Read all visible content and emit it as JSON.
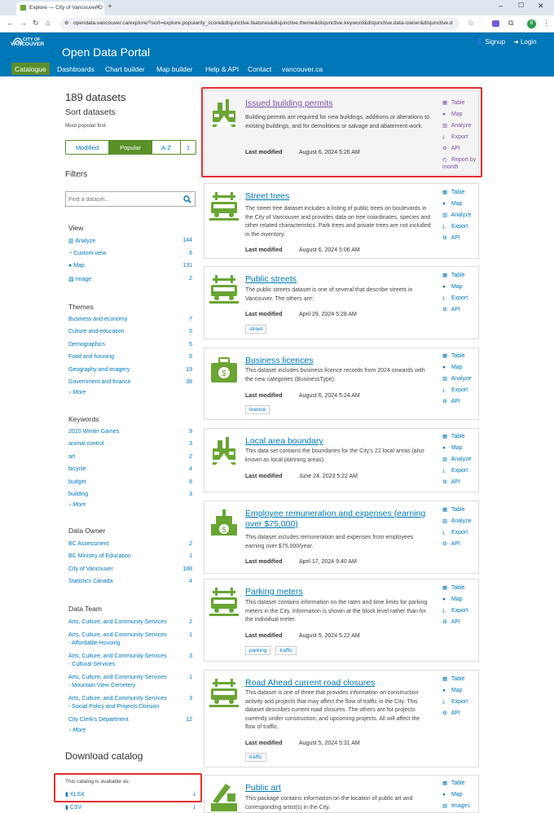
{
  "browser": {
    "tab_title": "Explore — City of Vancouver O",
    "url": "opendata.vancouver.ca/explore/?sort=explore.popularity_score&disjunctive.features&disjunctive.theme&disjunctive.keyword&disjunctive.data-owner&disjunctive.d"
  },
  "header": {
    "logo_line1": "CITY OF",
    "logo_line2": "VANCOUVER",
    "title": "Open Data Portal",
    "signup": "Signup",
    "login": "Login",
    "nav": [
      "Catalogue",
      "Dashboards",
      "Chart builder",
      "Map builder",
      "Help & API",
      "Contact",
      "vancouver.ca"
    ]
  },
  "left": {
    "count": "189 datasets",
    "sort_title": "Sort datasets",
    "sort_sub": "Most popular first",
    "sort_options": [
      "Modified",
      "Popular",
      "A-Z",
      "1"
    ],
    "filters_title": "Filters",
    "search_placeholder": "Find a dataset...",
    "view": {
      "title": "View",
      "items": [
        {
          "label": "Analyze",
          "count": "144"
        },
        {
          "label": "Custom view",
          "count": "6"
        },
        {
          "label": "Map",
          "count": "131"
        },
        {
          "label": "Image",
          "count": "2"
        }
      ]
    },
    "themes": {
      "title": "Themes",
      "items": [
        {
          "label": "Business and economy",
          "count": "7"
        },
        {
          "label": "Culture and education",
          "count": "5"
        },
        {
          "label": "Demographics",
          "count": "5"
        },
        {
          "label": "Food and housing",
          "count": "6"
        },
        {
          "label": "Geography and imagery",
          "count": "19"
        },
        {
          "label": "Government and finance",
          "count": "38"
        }
      ],
      "more": "More"
    },
    "keywords": {
      "title": "Keywords",
      "items": [
        {
          "label": "2010 Winter Games",
          "count": "9"
        },
        {
          "label": "animal control",
          "count": "3"
        },
        {
          "label": "art",
          "count": "2"
        },
        {
          "label": "bicycle",
          "count": "4"
        },
        {
          "label": "budget",
          "count": "8"
        },
        {
          "label": "building",
          "count": "3"
        }
      ],
      "more": "More"
    },
    "data_owner": {
      "title": "Data Owner",
      "items": [
        {
          "label": "BC Assessment",
          "count": "2"
        },
        {
          "label": "BC Ministry of Education",
          "count": "1"
        },
        {
          "label": "City of Vancouver",
          "count": "188"
        },
        {
          "label": "Statistics Canada",
          "count": "4"
        }
      ]
    },
    "data_team": {
      "title": "Data Team",
      "items": [
        {
          "line1": "Arts, Culture, and Community Services",
          "line2": "",
          "count": "2"
        },
        {
          "line1": "Arts, Culture, and Community Services",
          "line2": "- Affordable Housing",
          "count": "1"
        },
        {
          "line1": "Arts, Culture, and Community Services",
          "line2": "- Cultural Services",
          "count": "3"
        },
        {
          "line1": "Arts, Culture, and Community Services",
          "line2": "- Mountain View Cemetery",
          "count": "1"
        },
        {
          "line1": "Arts, Culture, and Community Services",
          "line2": "- Social Policy and Projects Division",
          "count": "3"
        },
        {
          "line1": "City Clerk's Department",
          "line2": "",
          "count": "12"
        }
      ],
      "more": "More"
    },
    "download": {
      "title": "Download catalog",
      "sub": "This catalog is available as:",
      "formats": [
        "XLSX",
        "CSV"
      ]
    }
  },
  "datasets": [
    {
      "title": "Issued building permits",
      "desc": "Building permits are required for new buildings, additions or alterations to existing buildings, and for demolitions or salvage and abatement work.",
      "lm_label": "Last modified",
      "lm": "August 6, 2024 5:26 AM",
      "tags": [],
      "actions": [
        "Table",
        "Map",
        "Analyze",
        "Export",
        "API",
        "Report by month"
      ]
    },
    {
      "title": "Street trees",
      "desc": "The street tree dataset includes a listing of public trees on boulevards in the City of Vancouver and provides data on tree coordinates, species and other related characteristics. Park trees and private trees are not included in the inventory.",
      "lm_label": "Last modified",
      "lm": "August 6, 2024 5:06 AM",
      "tags": [],
      "actions": [
        "Table",
        "Map",
        "Analyze",
        "Export",
        "API"
      ]
    },
    {
      "title": "Public streets",
      "desc": "The public streets dataset is one of several that describe streets in Vancouver. The others are:",
      "lm_label": "Last modified",
      "lm": "April 29, 2024 5:28 AM",
      "tags": [
        "street"
      ],
      "actions": [
        "Table",
        "Map",
        "Export",
        "API"
      ]
    },
    {
      "title": "Business licences",
      "desc": "This dataset includes business licence records from 2024 onwards with the new categories (BusinessType).",
      "lm_label": "Last modified",
      "lm": "August 6, 2024 5:24 AM",
      "tags": [
        "licence"
      ],
      "actions": [
        "Table",
        "Map",
        "Analyze",
        "Export",
        "API"
      ]
    },
    {
      "title": "Local area boundary",
      "desc": "This data set contains the boundaries for the City's 22 local areas (also known as local planning areas).",
      "lm_label": "Last modified",
      "lm": "June 24, 2023 5:22 AM",
      "tags": [],
      "actions": [
        "Table",
        "Map",
        "Analyze",
        "Export",
        "API"
      ]
    },
    {
      "title": "Employee remuneration and expenses (earning over $75,000)",
      "desc": "This dataset includes remuneration and expenses from employees earning over $75,000/year.",
      "lm_label": "Last modified",
      "lm": "April 17, 2024 9:40 AM",
      "tags": [],
      "actions": [
        "Table",
        "Analyze",
        "Export",
        "API"
      ]
    },
    {
      "title": "Parking meters",
      "desc": "This dataset contains information on the rates and time limits for parking meters in the City. Information is shown at the block level rather than for the individual meter.",
      "lm_label": "Last modified",
      "lm": "August 5, 2024 5:22 AM",
      "tags": [
        "parking",
        "traffic"
      ],
      "actions": [
        "Table",
        "Map",
        "Export",
        "API"
      ]
    },
    {
      "title": "Road Ahead current road closures",
      "desc": "This dataset is one of three that provides information on construction activity and projects that may affect the flow of traffic in the City. This dataset describes current road closures. The others are for projects currently under construction, and upcoming projects. All will affect the flow of traffic.",
      "lm_label": "Last modified",
      "lm": "August 5, 2024 5:31 AM",
      "tags": [
        "traffic"
      ],
      "actions": [
        "Table",
        "Map",
        "Export",
        "API"
      ]
    },
    {
      "title": "Public art",
      "desc": "This package contains information on the location of public art and corresponding artist(s) in the City.",
      "lm_label": "",
      "lm": "",
      "tags": [],
      "actions": [
        "Table",
        "Map",
        "Images"
      ]
    }
  ],
  "colors": {
    "header": "#0077b6",
    "nav_active": "#5a8f2a",
    "icon_green": "#6aa534",
    "link": "#0077b6",
    "visited": "#7b52a0",
    "highlight": "#e03030"
  }
}
